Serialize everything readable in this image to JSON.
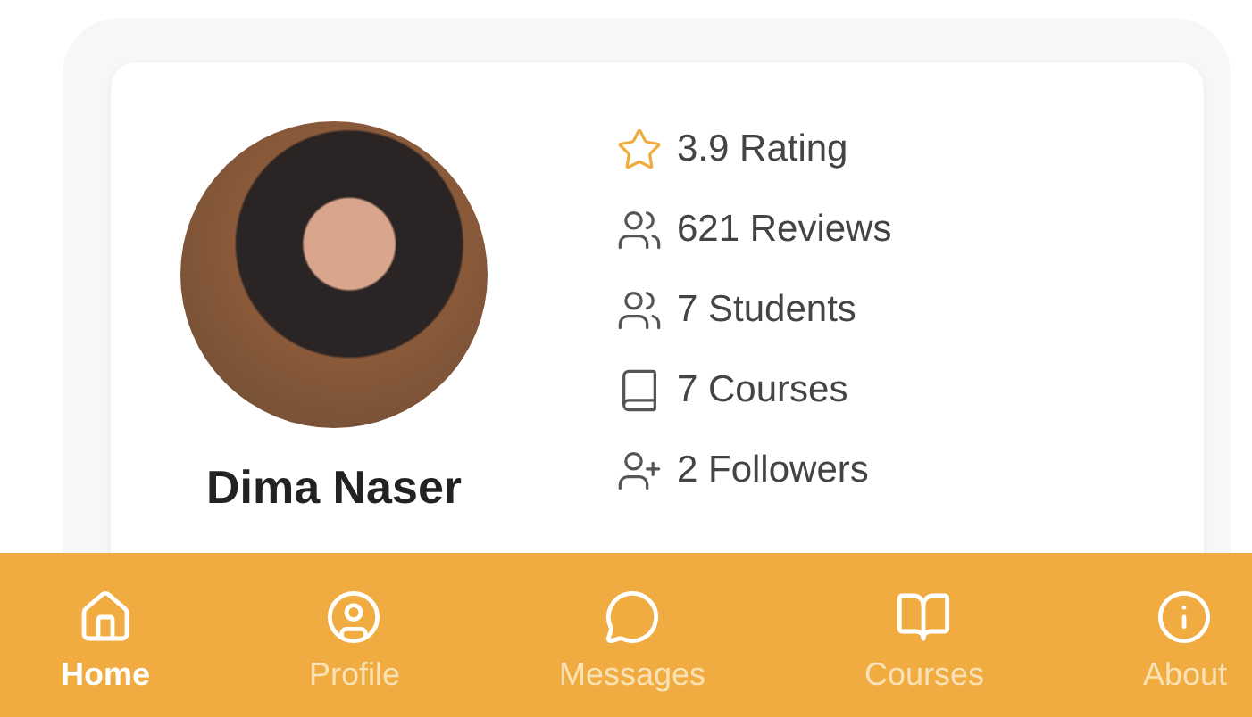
{
  "profile": {
    "name": "Dima Naser"
  },
  "stats": [
    {
      "kind": "rating",
      "text": "3.9 Rating"
    },
    {
      "kind": "reviews",
      "text": "621 Reviews"
    },
    {
      "kind": "students",
      "text": "7 Students"
    },
    {
      "kind": "courses",
      "text": "7 Courses"
    },
    {
      "kind": "followers",
      "text": "2 Followers"
    }
  ],
  "tabs": [
    {
      "kind": "home",
      "label": "Home",
      "selected": true
    },
    {
      "kind": "profile",
      "label": "Profile",
      "selected": false
    },
    {
      "kind": "messages",
      "label": "Messages",
      "selected": false
    },
    {
      "kind": "courses",
      "label": "Courses",
      "selected": false
    },
    {
      "kind": "about",
      "label": "About",
      "selected": false
    }
  ]
}
